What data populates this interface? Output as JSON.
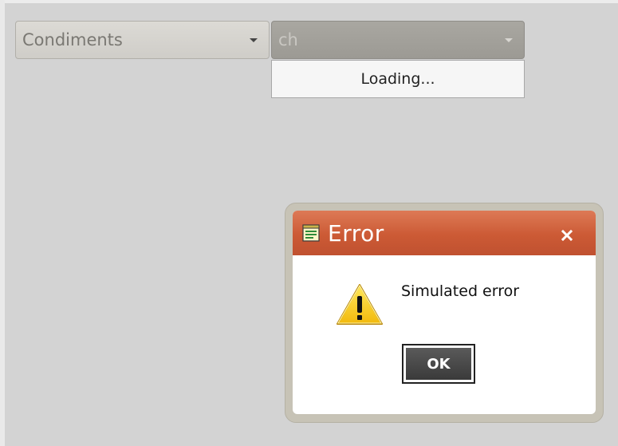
{
  "combo_category": {
    "value": "Condiments",
    "arrow_icon": "chevron-down-icon"
  },
  "combo_product": {
    "value": "ch",
    "arrow_icon": "chevron-down-icon"
  },
  "dropdown": {
    "status_text": "Loading..."
  },
  "dialog": {
    "title": "Error",
    "title_icon": "window-icon",
    "close_icon": "close-icon",
    "warning_icon": "warning-icon",
    "message": "Simulated error",
    "ok_label": "OK",
    "title_bar_color": "#cc5a35"
  }
}
